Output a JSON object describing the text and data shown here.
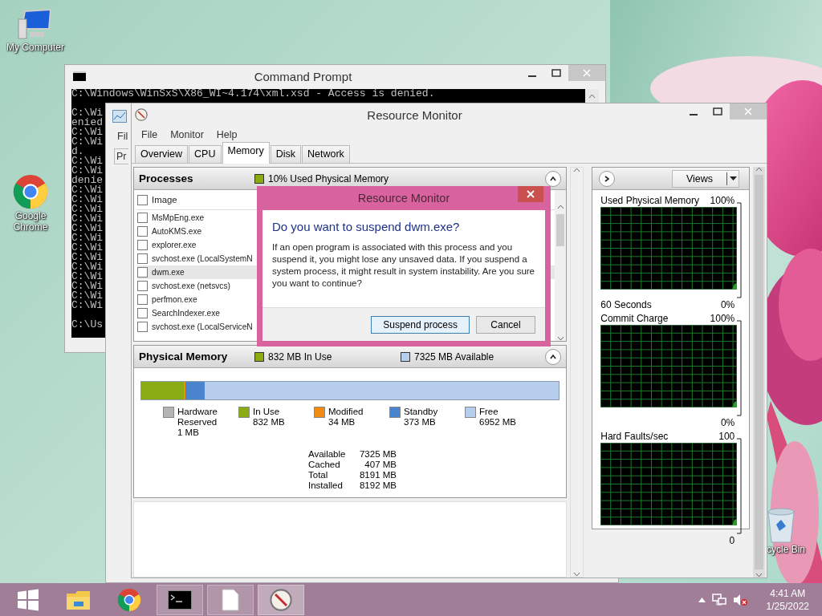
{
  "desktop": {
    "icons": [
      {
        "kind": "computer",
        "label": "My Computer"
      },
      {
        "kind": "chrome",
        "label": "Google Chrome"
      },
      {
        "kind": "recycle",
        "label": "cycle Bin"
      }
    ]
  },
  "command_prompt": {
    "title": "Command Prompt",
    "first_line": "C:\\Windows\\WinSxS\\X86_WI~4.174\\xml.xsd - Access is denied.",
    "lines": [
      "C:\\Wi",
      "enied",
      "C:\\Wi",
      "C:\\Wi",
      "d.",
      "C:\\Wi",
      "C:\\Wi",
      "denie",
      "C:\\Wi",
      "C:\\Wi",
      "C:\\Wi",
      "C:\\Wi",
      "C:\\Wi",
      "C:\\Wi",
      "C:\\Wi",
      "C:\\Wi",
      "C:\\Wi",
      "C:\\Wi",
      "C:\\Wi",
      "C:\\Wi",
      "C:\\Wi"
    ],
    "prompt": "C:\\Us"
  },
  "background_window": {
    "menu_fragment": "Fil",
    "tab_fragment": "Pr"
  },
  "resource_monitor": {
    "title": "Resource Monitor",
    "menu": [
      "File",
      "Monitor",
      "Help"
    ],
    "tabs": [
      {
        "label": "Overview",
        "selected": false
      },
      {
        "label": "CPU",
        "selected": false
      },
      {
        "label": "Memory",
        "selected": true
      },
      {
        "label": "Disk",
        "selected": false
      },
      {
        "label": "Network",
        "selected": false
      }
    ],
    "processes": {
      "title": "Processes",
      "summary": "10% Used Physical Memory",
      "column": "Image",
      "header_checked": false,
      "rows": [
        {
          "name": "MsMpEng.exe",
          "checked": false,
          "selected": false
        },
        {
          "name": "AutoKMS.exe",
          "checked": false,
          "selected": false
        },
        {
          "name": "explorer.exe",
          "checked": false,
          "selected": false
        },
        {
          "name": "svchost.exe (LocalSystemN",
          "checked": false,
          "selected": false
        },
        {
          "name": "dwm.exe",
          "checked": false,
          "selected": true
        },
        {
          "name": "svchost.exe (netsvcs)",
          "checked": false,
          "selected": false
        },
        {
          "name": "perfmon.exe",
          "checked": false,
          "selected": false
        },
        {
          "name": "SearchIndexer.exe",
          "checked": false,
          "selected": false
        },
        {
          "name": "svchost.exe (LocalServiceN",
          "checked": false,
          "selected": false
        }
      ]
    },
    "physical_memory": {
      "title": "Physical Memory",
      "in_use": "832 MB In Use",
      "available": "7325 MB Available",
      "legend": [
        {
          "label": "Hardware Reserved",
          "value": "1 MB",
          "color": "#b4b4b4"
        },
        {
          "label": "In Use",
          "value": "832 MB",
          "color": "#8aac12"
        },
        {
          "label": "Modified",
          "value": "34 MB",
          "color": "#f08a10"
        },
        {
          "label": "Standby",
          "value": "373 MB",
          "color": "#4a84cc"
        },
        {
          "label": "Free",
          "value": "6952 MB",
          "color": "#b6cdec"
        }
      ],
      "stats": [
        {
          "label": "Available",
          "value": "7325 MB"
        },
        {
          "label": "Cached",
          "value": "407 MB"
        },
        {
          "label": "Total",
          "value": "8191 MB"
        },
        {
          "label": "Installed",
          "value": "8192 MB"
        }
      ]
    },
    "views_button": "Views",
    "graphs": [
      {
        "title": "Used Physical Memory",
        "max": "100%",
        "min": "0%",
        "time": "60 Seconds"
      },
      {
        "title": "Commit Charge",
        "max": "100%",
        "min": "0%"
      },
      {
        "title": "Hard Faults/sec",
        "max": "100",
        "min": "0"
      }
    ]
  },
  "dialog": {
    "title": "Resource Monitor",
    "heading": "Do you want to suspend dwm.exe?",
    "message": "If an open program is associated with this process and you suspend it, you might lose any unsaved data. If you suspend a system process, it might result in system instability. Are you sure you want to continue?",
    "buttons": [
      {
        "label": "Suspend process",
        "default": true
      },
      {
        "label": "Cancel",
        "default": false
      }
    ]
  },
  "taskbar": {
    "apps": [
      {
        "kind": "start",
        "open": false,
        "selected": false
      },
      {
        "kind": "explorer",
        "open": false,
        "selected": false
      },
      {
        "kind": "chrome",
        "open": false,
        "selected": false
      },
      {
        "kind": "cmd",
        "open": true,
        "selected": false
      },
      {
        "kind": "file",
        "open": true,
        "selected": false
      },
      {
        "kind": "resmon",
        "open": true,
        "selected": true
      }
    ],
    "time": "4:41 AM",
    "date": "1/25/2022"
  }
}
